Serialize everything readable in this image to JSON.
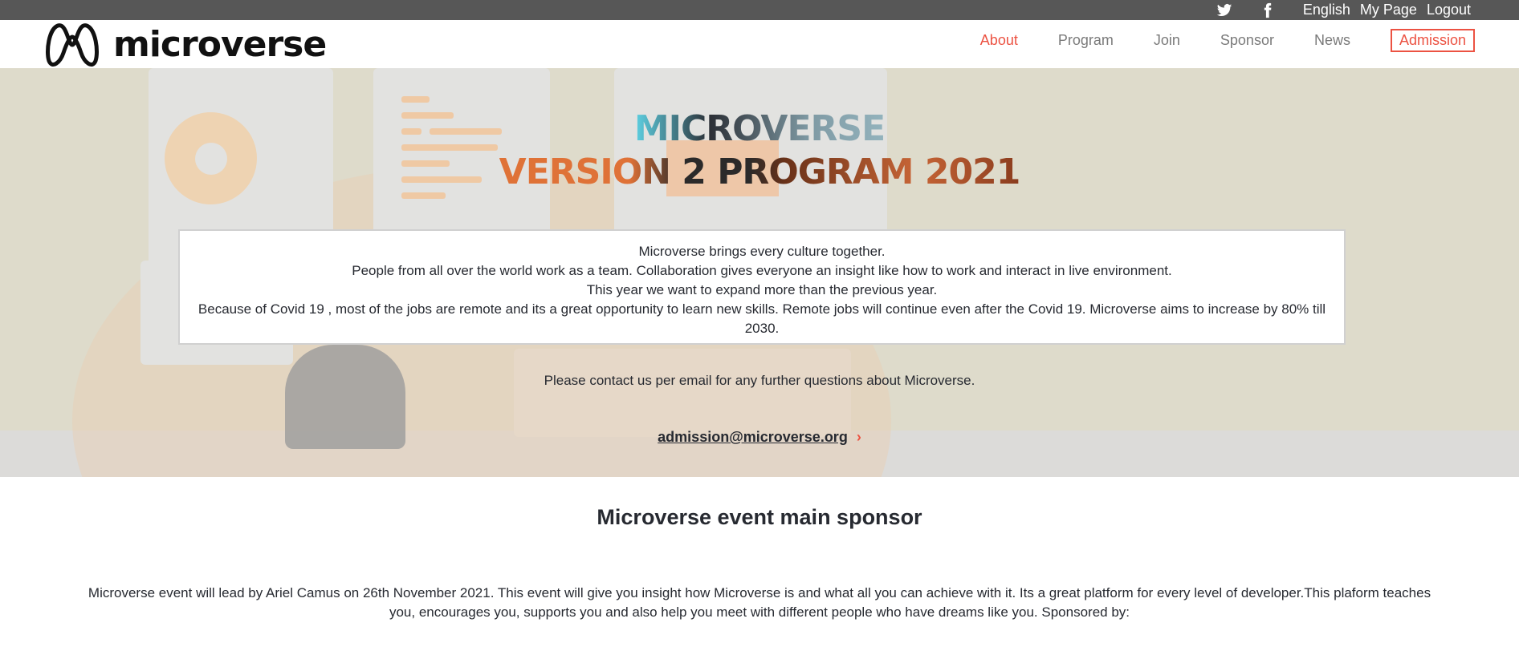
{
  "topbar": {
    "social": [
      {
        "icon": "twitter-icon"
      },
      {
        "icon": "facebook-icon"
      }
    ],
    "language": "English",
    "my_page": "My Page",
    "logout": "Logout"
  },
  "header": {
    "logo_text": "microverse",
    "nav": [
      {
        "label": "About"
      },
      {
        "label": "Program"
      },
      {
        "label": "Join"
      },
      {
        "label": "Sponsor"
      },
      {
        "label": "News"
      }
    ],
    "admission_label": "Admission"
  },
  "hero": {
    "title_line1": "MICROVERSE",
    "title_line2": "VERSION 2 PROGRAM 2021",
    "about_lines": [
      "Microverse brings every culture together.",
      "People from all over the world work as a team. Collaboration gives everyone an insight like how to work and interact in live environment.",
      "This year we want to expand more than the previous year.",
      "Because of Covid 19 , most of the jobs are remote and its a great opportunity to learn new skills. Remote jobs will continue even after the Covid 19. Microverse aims to increase by 80% till 2030."
    ],
    "contact_text": "Please contact us per email for any further questions about Microverse.",
    "email": "admission@microverse.org",
    "email_arrow": "›"
  },
  "sponsor": {
    "title": "Microverse event main sponsor",
    "text": "Microverse event will lead by Ariel Camus on 26th November 2021. This event will give you insight how Microverse is and what all you can achieve with it. Its a great platform for every level of developer.This plaform teaches you, encourages you, supports you and also help you meet with different people who have dreams like you. Sponsored by:"
  },
  "colors": {
    "accent": "#ec5242",
    "text": "#272a31",
    "topbar": "#575757"
  }
}
